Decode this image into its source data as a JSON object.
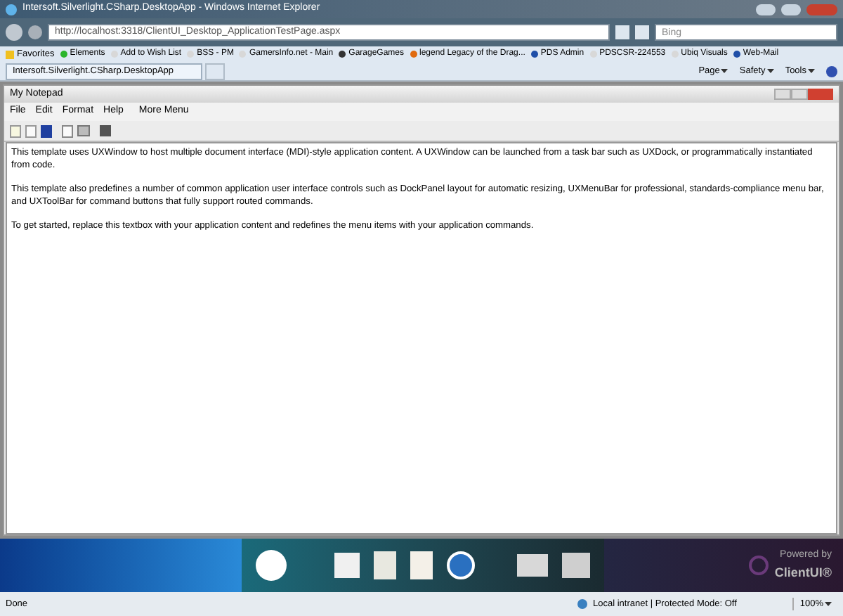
{
  "browser": {
    "title": "Intersoft.Silverlight.CSharp.DesktopApp - Windows Internet Explorer",
    "address": "http://localhost:3318/ClientUI_Desktop_ApplicationTestPage.aspx",
    "search_placeholder": "Bing"
  },
  "favorites": {
    "label": "Favorites",
    "items": [
      {
        "label": "Elements",
        "kind": "green"
      },
      {
        "label": "Add to Wish List",
        "kind": "page"
      },
      {
        "label": "BSS - PM",
        "kind": "page"
      },
      {
        "label": "GamersInfo.net - Main",
        "kind": "page"
      },
      {
        "label": "GarageGames",
        "kind": "dark"
      },
      {
        "label": "legend Legacy of the Drag...",
        "kind": "orange"
      },
      {
        "label": "PDS Admin",
        "kind": "blue"
      },
      {
        "label": "PDSCSR-224553",
        "kind": "page"
      },
      {
        "label": "Ubiq Visuals",
        "kind": "page"
      },
      {
        "label": "Web-Mail",
        "kind": "blue"
      }
    ]
  },
  "tab": {
    "label": "Intersoft.Silverlight.CSharp.DesktopApp"
  },
  "command_bar": [
    "Page",
    "Safety",
    "Tools"
  ],
  "notepad": {
    "title": "My Notepad",
    "menu": [
      "File",
      "Edit",
      "Format",
      "Help",
      "More Menu"
    ],
    "paragraphs": [
      "This template uses UXWindow to host multiple document interface (MDI)-style application content. A UXWindow can be launched from a task bar such as UXDock, or programmatically instantiated from code.",
      "This template also predefines  a number of common application user interface controls such as DockPanel layout for automatic resizing, UXMenuBar for professional, standards-compliance menu bar, and UXToolBar for command buttons that fully support routed commands.",
      "To get started, replace this textbox with your application content and redefines the menu items with your application commands."
    ]
  },
  "dock": {
    "powered_by": "Powered by",
    "brand": "ClientUI®"
  },
  "status_bar": {
    "left": "Done",
    "zone": "Local intranet | Protected Mode: Off",
    "zoom": "100%"
  }
}
